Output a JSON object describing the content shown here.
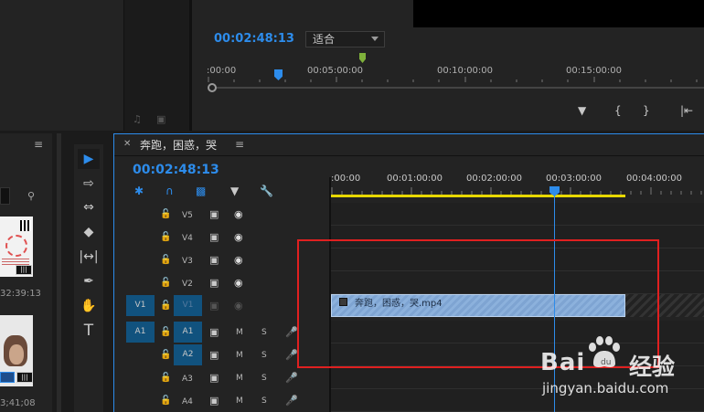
{
  "program_monitor": {
    "timecode": "00:02:48:13",
    "fit": "适合",
    "ruler_labels": [
      ":00:00",
      "00:05:00:00",
      "00:10:00:00",
      "00:15:00:00"
    ],
    "controls": [
      "marker-icon",
      "mark-in-icon",
      "mark-out-icon",
      "go-to-in-icon"
    ]
  },
  "project_panel": {
    "item1_duration": "32:39:13",
    "item2_duration": "3;41;08"
  },
  "tools": [
    "selection-tool",
    "track-select-tool",
    "ripple-edit-tool",
    "razor-tool",
    "slip-tool",
    "pen-tool",
    "hand-tool",
    "type-tool"
  ],
  "timeline": {
    "sequence_name": "奔跑，困惑，哭",
    "timecode": "00:02:48:13",
    "ruler_labels": [
      ":00:00",
      "00:01:00:00",
      "00:02:00:00",
      "00:03:00:00",
      "00:04:00:00"
    ],
    "video_tracks": [
      "V5",
      "V4",
      "V3",
      "V2",
      "V1"
    ],
    "audio_tracks": [
      "A1",
      "A2",
      "A3",
      "A4"
    ],
    "source_v1": "V1",
    "source_a1": "A1",
    "mute_label": "M",
    "solo_label": "S",
    "clip_label": "奔跑，困惑，哭.mp4"
  },
  "watermark": {
    "brand": "Bai",
    "brand2": "经验",
    "url": "jingyan.baidu.com"
  },
  "colors": {
    "accent": "#2d8ceb",
    "work_area": "#e8d800",
    "highlight": "#e02020",
    "clip": "#8cb1dc"
  }
}
